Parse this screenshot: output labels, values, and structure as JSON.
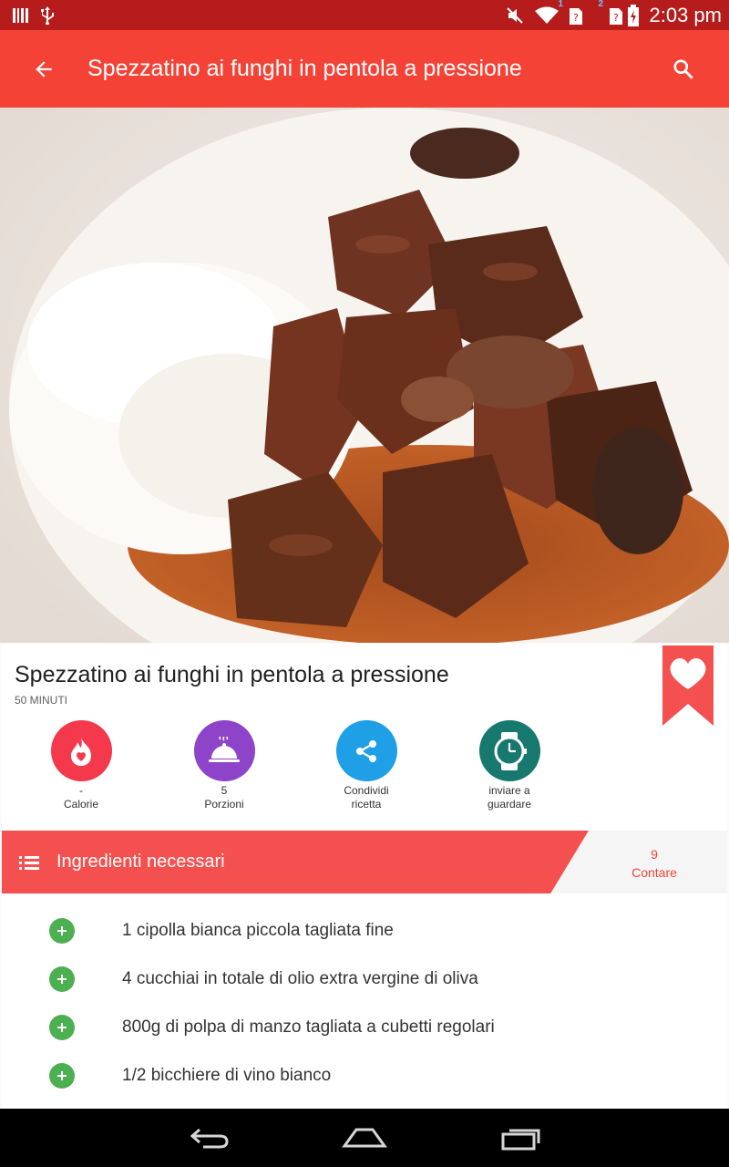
{
  "status_bar": {
    "time": "2:03 pm",
    "sim1_label": "1",
    "sim2_label": "2",
    "icons": [
      "barcode-icon",
      "usb-icon",
      "mute-icon",
      "wifi-icon",
      "sim-unknown-icon",
      "battery-charging-icon"
    ]
  },
  "app_bar": {
    "title": "Spezzatino ai funghi in pentola a pressione",
    "back_icon": "arrow-back-icon",
    "search_icon": "search-icon"
  },
  "recipe": {
    "title": "Spezzatino ai funghi in pentola a pressione",
    "time": "50 MINUTI",
    "bookmark_icon": "heart-bookmark-icon"
  },
  "actions": [
    {
      "value": "-",
      "label": "Calorie",
      "icon": "flame-heart-icon",
      "color": "#f5394c"
    },
    {
      "value": "5",
      "label": "Porzioni",
      "icon": "cloche-icon",
      "color": "#8e44c8"
    },
    {
      "value": "",
      "label": "Condividi ricetta",
      "icon": "share-icon",
      "color": "#1e9fe6"
    },
    {
      "value": "",
      "label": "inviare a guardare",
      "icon": "watch-icon",
      "color": "#17786e"
    }
  ],
  "ingredients_header": {
    "title": "Ingredienti necessari",
    "count": "9",
    "count_label": "Contare"
  },
  "ingredients": [
    "1 cipolla bianca piccola tagliata fine",
    "4 cucchiai in totale di olio extra vergine di oliva",
    "800g di polpa di manzo tagliata a cubetti regolari",
    "1/2 bicchiere di vino bianco"
  ],
  "colors": {
    "status_bar": "#b71c1c",
    "app_bar": "#f44336",
    "ingredients_header": "#f55050",
    "plus_button": "#4caf50"
  }
}
